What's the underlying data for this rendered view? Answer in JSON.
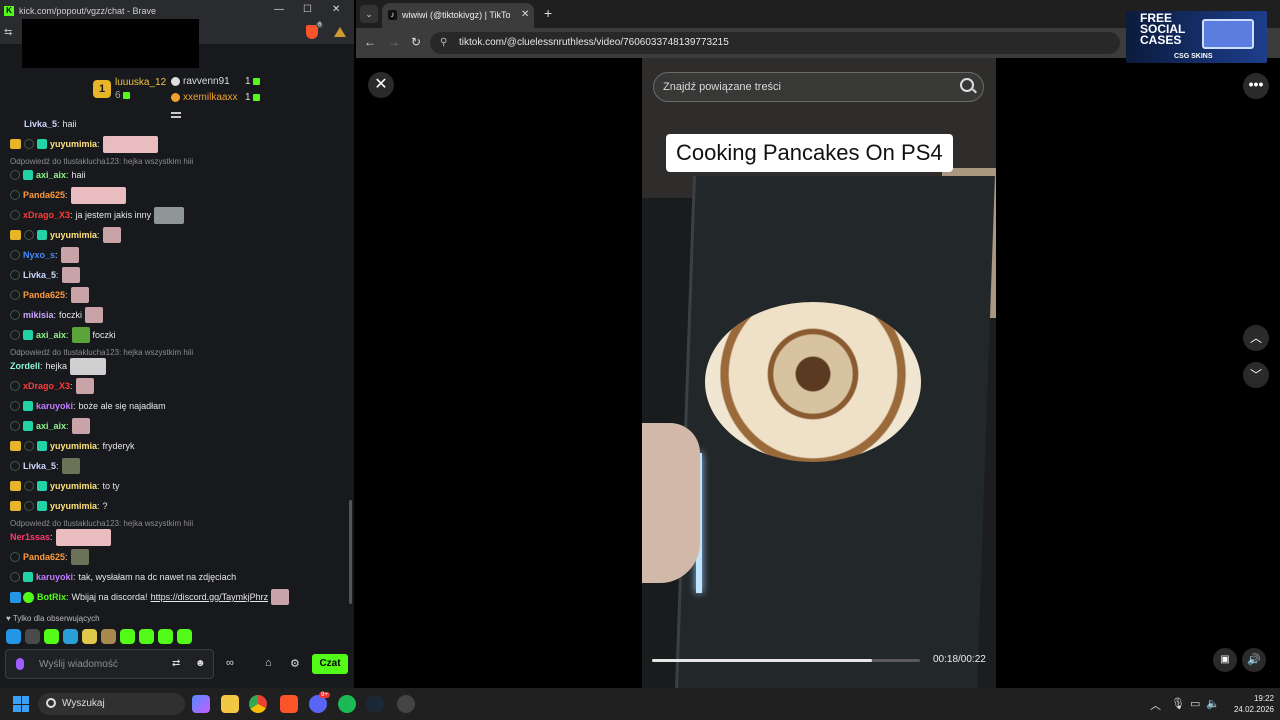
{
  "kick": {
    "title": "kick.com/popout/vgzz/chat - Brave",
    "brave_badge": "6",
    "leaderboard": {
      "rank": "1",
      "first_name": "luuuska_12",
      "first_count": "6",
      "second_name": "ravvenn91",
      "second_count": "1",
      "third_name": "xxemilkaaxx",
      "third_count": "1"
    },
    "messages": {
      "m0_user": "Livka_5",
      "m0_text": "haii",
      "m1_user": "yuyumimia",
      "r1": "Odpowiedź do tlustaklucha123: hejka wszystkim hiii",
      "m2_user": "axi_aix",
      "m2_text": "haii",
      "m3_user": "Panda625",
      "m4_user": "xDrago_X3",
      "m4_text": "ja jestem jakis inny",
      "m5_user": "yuyumimia",
      "m6_user": "Nyxo_s",
      "m7_user": "Livka_5",
      "m8_user": "Panda625",
      "m9_user": "mikisia",
      "m9_text": "foczki",
      "m10_user": "axi_aix",
      "m10_text": "foczki",
      "r2": "Odpowiedź do tlustaklucha123: hejka wszystkim hiii",
      "m11_user": "Zordell",
      "m11_text": "hejka",
      "m12_user": "xDrago_X3",
      "m13_user": "karuyoki",
      "m13_text": "boże ale się najadłam",
      "m14_user": "axi_aix",
      "m15_user": "yuyumimia",
      "m15_text": "fryderyk",
      "m16_user": "Livka_5",
      "m17_user": "yuyumimia",
      "m17_text": "to ty",
      "m18_user": "yuyumimia",
      "m18_text": "?",
      "r3": "Odpowiedź do tlustaklucha123: hejka wszystkim hiii",
      "m19_user": "Ner1ssas",
      "m20_user": "Panda625",
      "m21_user": "karuyoki",
      "m21_text": "tak, wysłałam na dc nawet na zdjęciach",
      "m22_user": "BotRix",
      "m22_text": "Wbijaj na discorda!",
      "m22_link": "https://discord.gg/TaymkjPhrz"
    },
    "followers_only": "Tylko dla obserwujących",
    "input_placeholder": "Wyślij wiadomość",
    "send_label": "Czat",
    "colors": {
      "accent": "#53fc18",
      "background": "#17191c"
    }
  },
  "browser": {
    "tab_title": "wiwiwi (@tiktokivgz) | TikTok",
    "url": "tiktok.com/@cluelessnruthless/video/7606033748139773215",
    "ad": {
      "line1": "FREE",
      "line2": "SOCIAL",
      "line3": "CASES",
      "brand": "CSG SKINS"
    },
    "search_placeholder": "Znajdź powiązane treści",
    "caption": "Cooking Pancakes On PS4",
    "time": "00:18/00:22",
    "progress": 0.82
  },
  "taskbar": {
    "search_placeholder": "Wyszukaj",
    "discord_badge": "9+",
    "time": "19:22",
    "date": "24.02.2026"
  }
}
